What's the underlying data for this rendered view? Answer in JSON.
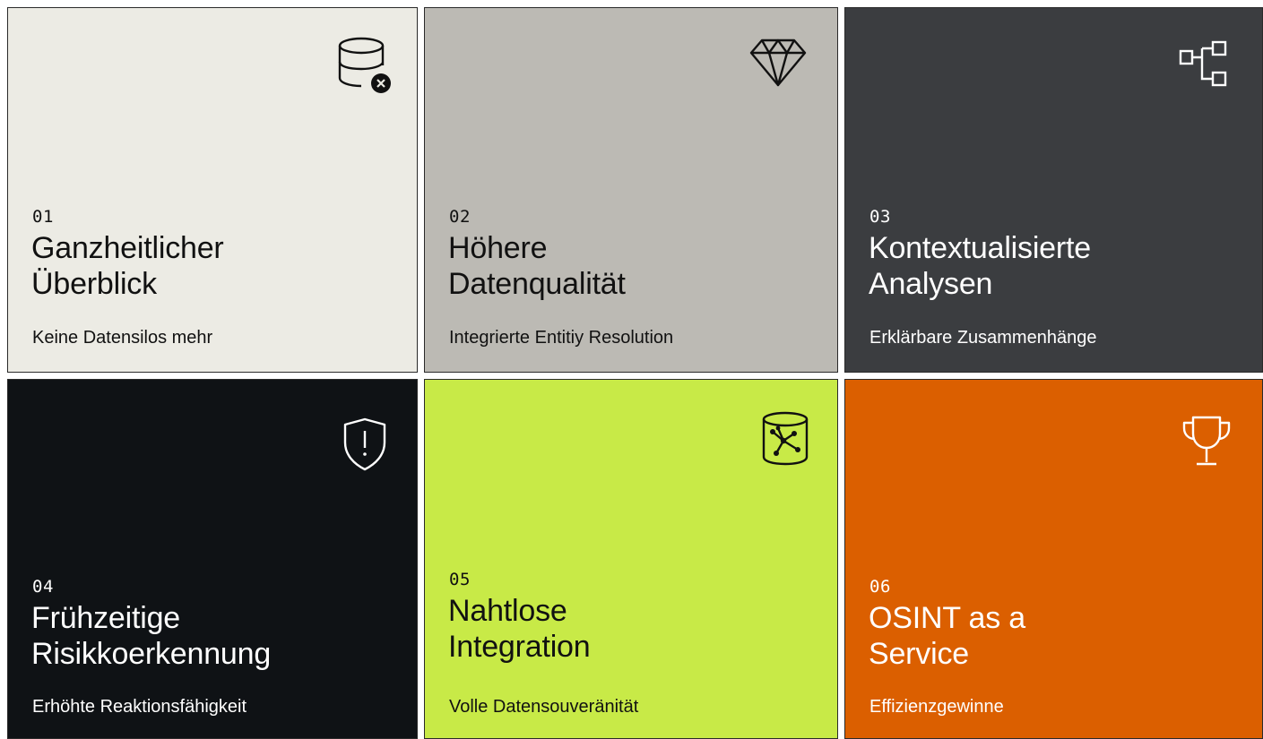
{
  "cards": [
    {
      "number": "01",
      "title_line1": "Ganzheitlicher",
      "title_line2": "Überblick",
      "subtitle": "Keine Datensilos mehr",
      "icon": "database-x-icon",
      "bg": "#ecebe4",
      "fg": "#111111"
    },
    {
      "number": "02",
      "title_line1": "Höhere",
      "title_line2": "Datenqualität",
      "subtitle": "Integrierte Entitiy Resolution",
      "icon": "diamond-icon",
      "bg": "#bcbab4",
      "fg": "#111111"
    },
    {
      "number": "03",
      "title_line1": "Kontextualisierte",
      "title_line2": "Analysen",
      "subtitle": "Erklärbare Zusammenhänge",
      "icon": "hierarchy-icon",
      "bg": "#3b3d40",
      "fg": "#ffffff"
    },
    {
      "number": "04",
      "title_line1": "Frühzeitige",
      "title_line2": "Risikkoerkennung",
      "subtitle": "Erhöhte Reaktionsfähigkeit",
      "icon": "shield-alert-icon",
      "bg": "#0f1215",
      "fg": "#ffffff"
    },
    {
      "number": "05",
      "title_line1": "Nahtlose",
      "title_line2": "Integration",
      "subtitle": "Volle Datensouveränität",
      "icon": "network-database-icon",
      "bg": "#c8ea47",
      "fg": "#111111"
    },
    {
      "number": "06",
      "title_line1": "OSINT as a",
      "title_line2": "Service",
      "subtitle": "Effizienzgewinne",
      "icon": "trophy-icon",
      "bg": "#db5f00",
      "fg": "#ffffff"
    }
  ]
}
